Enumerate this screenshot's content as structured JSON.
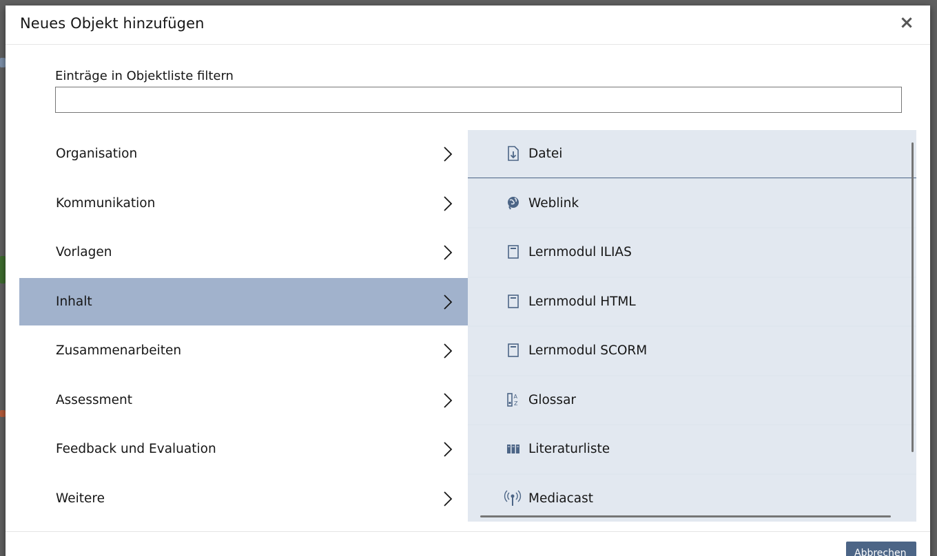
{
  "modal": {
    "title": "Neues Objekt hinzufügen",
    "close_symbol": "×"
  },
  "filter": {
    "label": "Einträge in Objektliste filtern",
    "value": "",
    "placeholder": ""
  },
  "categories": [
    {
      "label": "Organisation",
      "active": false
    },
    {
      "label": "Kommunikation",
      "active": false
    },
    {
      "label": "Vorlagen",
      "active": false
    },
    {
      "label": "Inhalt",
      "active": true
    },
    {
      "label": "Zusammenarbeiten",
      "active": false
    },
    {
      "label": "Assessment",
      "active": false
    },
    {
      "label": "Feedback und Evaluation",
      "active": false
    },
    {
      "label": "Weitere",
      "active": false
    }
  ],
  "objects": [
    {
      "label": "Datei",
      "icon": "file-download-icon"
    },
    {
      "label": "Weblink",
      "icon": "weblink-globe-icon"
    },
    {
      "label": "Lernmodul ILIAS",
      "icon": "learning-module-icon"
    },
    {
      "label": "Lernmodul HTML",
      "icon": "learning-module-icon"
    },
    {
      "label": "Lernmodul SCORM",
      "icon": "learning-module-icon"
    },
    {
      "label": "Glossar",
      "icon": "glossary-az-icon"
    },
    {
      "label": "Literaturliste",
      "icon": "books-icon"
    },
    {
      "label": "Mediacast",
      "icon": "broadcast-icon"
    }
  ],
  "footer": {
    "button_label": "Abbrechen"
  },
  "colors": {
    "active_category": "#a1b2cc",
    "object_bg": "#e2e8f0",
    "icon": "#4c6586",
    "accent": "#4c6586"
  }
}
